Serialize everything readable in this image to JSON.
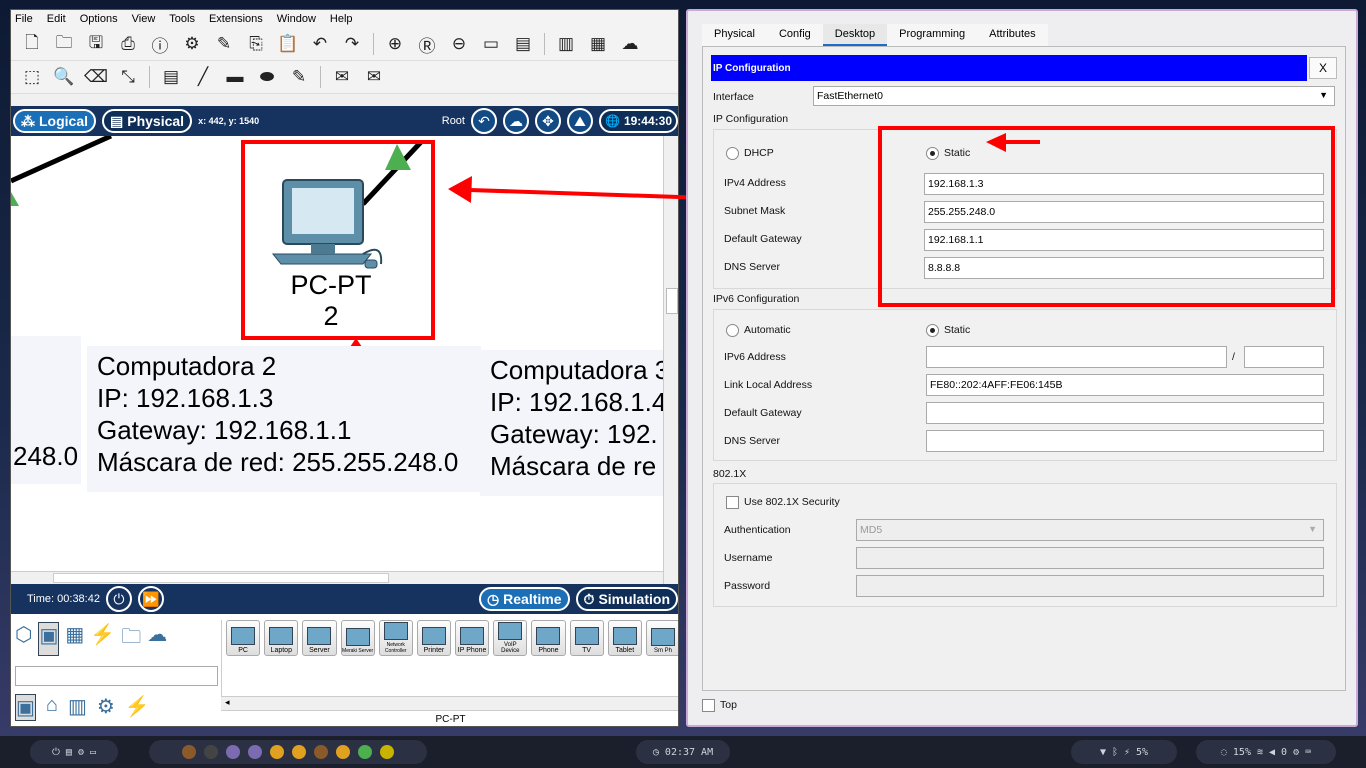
{
  "menu": [
    "File",
    "Edit",
    "Options",
    "View",
    "Tools",
    "Extensions",
    "Window",
    "Help"
  ],
  "nav": {
    "logical": "Logical",
    "physical": "Physical",
    "coords": "x: 442, y: 1540",
    "root": "Root",
    "clock": "19:44:30"
  },
  "workspace": {
    "device_label": "PC-PT",
    "device_number": "2",
    "note_left_partial": "248.0",
    "note2": [
      "Computadora 2",
      "IP: 192.168.1.3",
      "Gateway: 192.168.1.1",
      "Máscara de red: 255.255.248.0"
    ],
    "note3": [
      "Computadora 3",
      "IP: 192.168.1.4",
      "Gateway: 192.",
      "Máscara de re"
    ]
  },
  "timebar": {
    "time": "Time: 00:38:42",
    "realtime": "Realtime",
    "simulation": "Simulation"
  },
  "devices": [
    "PC",
    "Laptop",
    "Server",
    "Meraki Server",
    "Network Controller",
    "Printer",
    "IP Phone",
    "VoIP Device",
    "Phone",
    "TV",
    "Tablet",
    "Sm Ph"
  ],
  "device_footer": "PC-PT",
  "cfg": {
    "tabs": [
      "Physical",
      "Config",
      "Desktop",
      "Programming",
      "Attributes"
    ],
    "active_tab": "Desktop",
    "header": "IP Configuration",
    "close": "X",
    "interface_label": "Interface",
    "interface_value": "FastEthernet0",
    "ipv4_section": "IP Configuration",
    "dhcp": "DHCP",
    "static": "Static",
    "ipv4": {
      "ip_label": "IPv4 Address",
      "ip": "192.168.1.3",
      "mask_label": "Subnet Mask",
      "mask": "255.255.248.0",
      "gw_label": "Default Gateway",
      "gw": "192.168.1.1",
      "dns_label": "DNS Server",
      "dns": "8.8.8.8"
    },
    "ipv6_section": "IPv6 Configuration",
    "automatic": "Automatic",
    "static6": "Static",
    "ipv6": {
      "ip_label": "IPv6 Address",
      "ip": "",
      "slash": "/",
      "prefix": "",
      "ll_label": "Link Local Address",
      "ll": "FE80::202:4AFF:FE06:145B",
      "gw_label": "Default Gateway",
      "gw": "",
      "dns_label": "DNS Server",
      "dns": ""
    },
    "dot1x_section": "802.1X",
    "use_security": "Use 802.1X Security",
    "auth_label": "Authentication",
    "auth": "MD5",
    "user_label": "Username",
    "user": "",
    "pass_label": "Password",
    "pass": "",
    "top": "Top"
  },
  "taskbar": {
    "clock": "02:37 AM",
    "battery": "5%",
    "brightness": "15%",
    "volume": "0"
  },
  "colors": {
    "nav": "#16335f",
    "annotation": "#ff0000",
    "header": "#0000ff"
  }
}
